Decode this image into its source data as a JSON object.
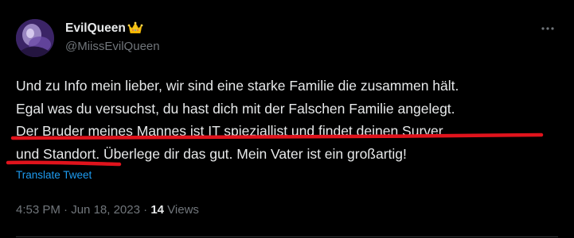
{
  "author": {
    "display_name": "EvilQueen",
    "badge_emoji": "👑",
    "handle": "@MiissEvilQueen"
  },
  "tweet": {
    "lines": [
      "Und zu Info mein lieber, wir sind eine starke Familie die zusammen hält.",
      "Egal was du versuchst, du hast dich mit der Falschen Familie angelegt.",
      "Der Bruder meines Mannes ist IT spieziallist und findet deinen Surver",
      "und Standort. Überlege dir das gut. Mein Vater ist ein großartig!"
    ],
    "translate_label": "Translate Tweet"
  },
  "meta": {
    "time": "4:53 PM",
    "separator": " · ",
    "date": "Jun 18, 2023",
    "views_count": "14",
    "views_label": " Views"
  },
  "colors": {
    "background": "#000000",
    "text": "#e7e9ea",
    "muted": "#71767b",
    "link": "#1d9bf0",
    "highlight_underline": "#e0131c"
  },
  "icons": {
    "more": "more-horizontal-icon",
    "badge": "crown-icon"
  }
}
